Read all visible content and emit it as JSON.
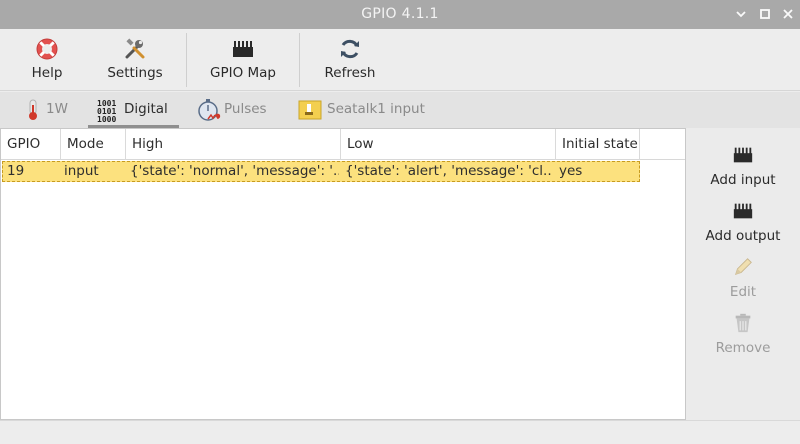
{
  "window": {
    "title": "GPIO 4.1.1"
  },
  "toolbar": {
    "help_label": "Help",
    "settings_label": "Settings",
    "gpio_map_label": "GPIO Map",
    "refresh_label": "Refresh"
  },
  "tabs": [
    {
      "label": "1W",
      "icon": "thermometer-icon",
      "active": false
    },
    {
      "label": "Digital",
      "icon": "binary-digits-icon",
      "active": true
    },
    {
      "label": "Pulses",
      "icon": "stopwatch-pulse-icon",
      "active": false
    },
    {
      "label": "Seatalk1 input",
      "icon": "seatalk-icon",
      "active": false
    }
  ],
  "table": {
    "columns": [
      "GPIO",
      "Mode",
      "High",
      "Low",
      "Initial state"
    ],
    "rows": [
      {
        "gpio": "19",
        "mode": "input",
        "high": "{'state': 'normal', 'message': '...",
        "low": "{'state': 'alert', 'message': 'cl...",
        "initial_state": "yes"
      }
    ]
  },
  "side_actions": {
    "add_input_label": "Add input",
    "add_output_label": "Add output",
    "edit_label": "Edit",
    "remove_label": "Remove"
  },
  "colors": {
    "titlebar": "#a9a9a9",
    "selected_row": "#fce17e",
    "help_icon": "#e2514f"
  }
}
